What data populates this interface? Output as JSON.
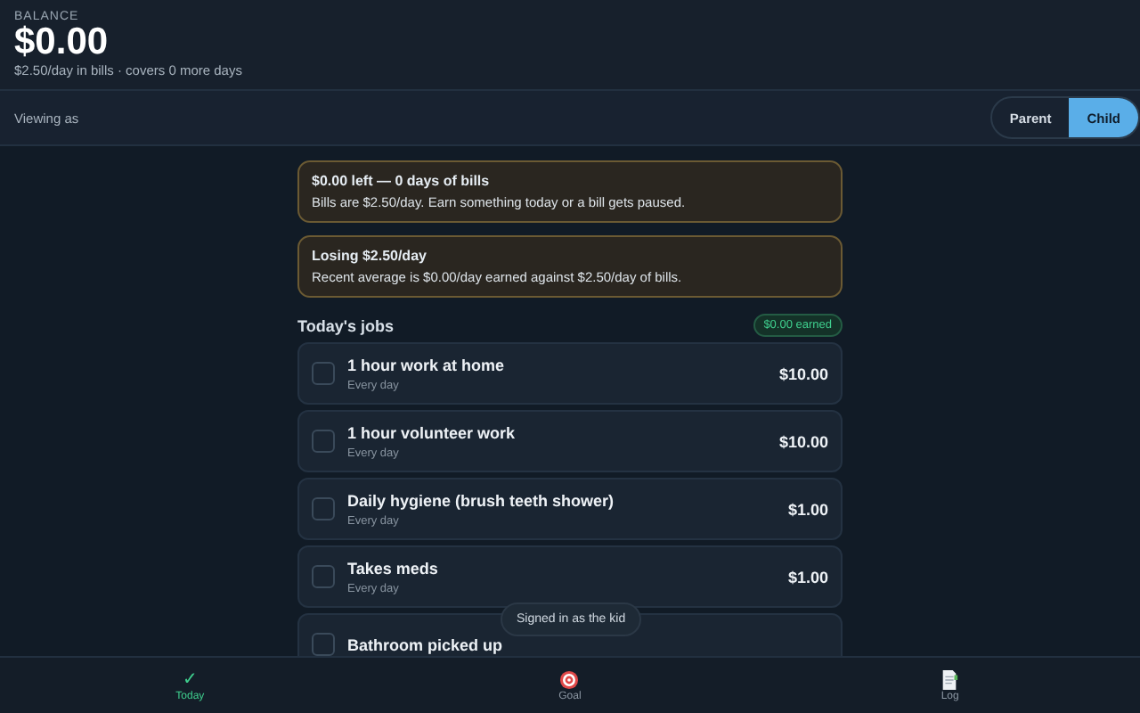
{
  "balance": {
    "label": "BALANCE",
    "amount": "$0.00",
    "note": "$2.50/day in bills · covers 0 more days"
  },
  "viewing": {
    "label": "Viewing as",
    "options": [
      {
        "label": "Parent",
        "selected": false
      },
      {
        "label": "Child",
        "selected": true
      }
    ]
  },
  "alerts": [
    {
      "title": "$0.00 left — 0 days of bills",
      "text": "Bills are $2.50/day. Earn something today or a bill gets paused."
    },
    {
      "title": "Losing $2.50/day",
      "text": "Recent average is $0.00/day earned against $2.50/day of bills."
    }
  ],
  "jobs": {
    "title": "Today's jobs",
    "earned": "$0.00 earned",
    "items": [
      {
        "name": "1 hour work at home",
        "repeat": "Every day",
        "amount": "$10.00",
        "checked": false
      },
      {
        "name": "1 hour volunteer work",
        "repeat": "Every day",
        "amount": "$10.00",
        "checked": false
      },
      {
        "name": "Daily hygiene (brush teeth shower)",
        "repeat": "Every day",
        "amount": "$1.00",
        "checked": false
      },
      {
        "name": "Takes meds",
        "repeat": "Every day",
        "amount": "$1.00",
        "checked": false
      },
      {
        "name": "Bathroom picked up",
        "checked": false
      }
    ]
  },
  "toast": "Signed in as the kid",
  "nav": [
    {
      "kind": "check",
      "glyph": "✓",
      "label": "Today",
      "selected": true
    },
    {
      "kind": "target",
      "label": "Goal",
      "selected": false
    },
    {
      "kind": "log",
      "label": "Log",
      "selected": false
    }
  ]
}
